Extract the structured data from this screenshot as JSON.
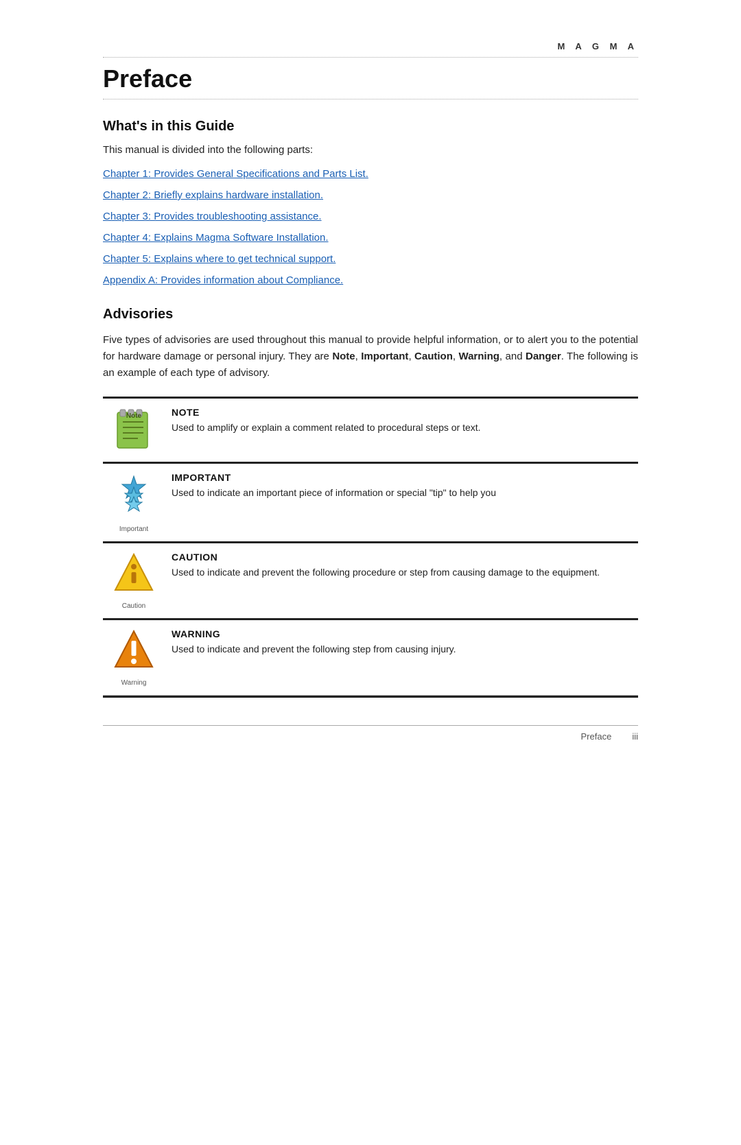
{
  "header": {
    "brand": "M A G M A"
  },
  "page": {
    "title": "Preface",
    "whats_in_guide": {
      "heading": "What's in this Guide",
      "intro": "This manual is divided into the following parts:",
      "chapters": [
        {
          "id": "chapter1",
          "text": "Chapter 1:  Provides General Specifications and Parts List."
        },
        {
          "id": "chapter2",
          "text": "Chapter 2:  Briefly explains hardware installation."
        },
        {
          "id": "chapter3",
          "text": "Chapter 3:  Provides troubleshooting assistance."
        },
        {
          "id": "chapter4",
          "text": "Chapter 4:  Explains Magma Software Installation."
        },
        {
          "id": "chapter5",
          "text": "Chapter 5:  Explains where to get technical support."
        },
        {
          "id": "appendixA",
          "text": "Appendix A: Provides information about Compliance."
        }
      ]
    },
    "advisories": {
      "heading": "Advisories",
      "intro": "Five types of advisories are used throughout this manual to provide helpful information, or to alert you to the potential for hardware damage or personal injury. They are Note, Important, Caution, Warning, and Danger. The following is an example of each type of advisory.",
      "intro_bold_words": [
        "Note",
        "Important",
        "Caution",
        "Warning",
        "Danger"
      ],
      "items": [
        {
          "id": "note",
          "label": "NOTE",
          "icon_label": "",
          "text": "Used to amplify or explain a comment related to procedural steps or text.",
          "icon_type": "note"
        },
        {
          "id": "important",
          "label": "IMPORTANT",
          "icon_label": "Important",
          "text": "Used to indicate an important piece of information or special \"tip\" to help you",
          "icon_type": "important"
        },
        {
          "id": "caution",
          "label": "CAUTION",
          "icon_label": "Caution",
          "text": "Used to indicate and prevent the following procedure or step from causing damage to the equipment.",
          "icon_type": "caution"
        },
        {
          "id": "warning",
          "label": "WARNING",
          "icon_label": "Warning",
          "text": "Used to indicate and prevent the following step from causing injury.",
          "icon_type": "warning"
        }
      ]
    }
  },
  "footer": {
    "left": "",
    "center": "Preface",
    "right": "iii"
  }
}
